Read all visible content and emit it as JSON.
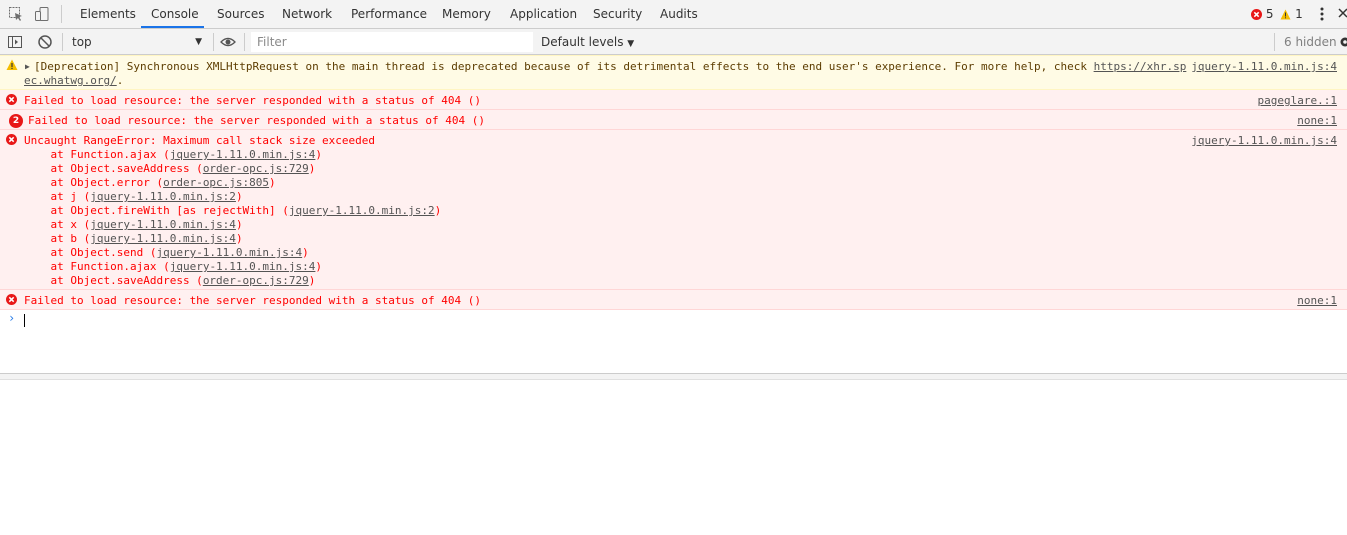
{
  "tabs": [
    {
      "label": "Elements"
    },
    {
      "label": "Console"
    },
    {
      "label": "Sources"
    },
    {
      "label": "Network"
    },
    {
      "label": "Performance"
    },
    {
      "label": "Memory"
    },
    {
      "label": "Application"
    },
    {
      "label": "Security"
    },
    {
      "label": "Audits"
    }
  ],
  "active_tab": "Console",
  "counts": {
    "errors": "5",
    "warnings": "1"
  },
  "toolbar": {
    "context": "top",
    "filter_placeholder": "Filter",
    "levels": "Default levels",
    "hidden": "6 hidden"
  },
  "messages": {
    "warning": {
      "line1": "[Deprecation] Synchronous XMLHttpRequest on the main thread is deprecated because of its detrimental effects to the end user's experience. For more help, check ",
      "link1": "https://xhr.sp",
      "link2": "ec.whatwg.org/",
      "tail": ".",
      "source": "jquery-1.11.0.min.js:4"
    },
    "error1": {
      "text": "Failed to load resource: the server responded with a status of 404 ()",
      "source": "pageglare.:1"
    },
    "error2": {
      "count": "2",
      "text": "Failed to load resource: the server responded with a status of 404 ()",
      "source": "none:1"
    },
    "error3": {
      "text": "Uncaught RangeError: Maximum call stack size exceeded",
      "source": "jquery-1.11.0.min.js:4",
      "stack": [
        {
          "prefix": "    at Function.ajax (",
          "link": "jquery-1.11.0.min.js:4",
          "suffix": ")"
        },
        {
          "prefix": "    at Object.saveAddress (",
          "link": "order-opc.js:729",
          "suffix": ")"
        },
        {
          "prefix": "    at Object.error (",
          "link": "order-opc.js:805",
          "suffix": ")"
        },
        {
          "prefix": "    at j (",
          "link": "jquery-1.11.0.min.js:2",
          "suffix": ")"
        },
        {
          "prefix": "    at Object.fireWith [as rejectWith] (",
          "link": "jquery-1.11.0.min.js:2",
          "suffix": ")"
        },
        {
          "prefix": "    at x (",
          "link": "jquery-1.11.0.min.js:4",
          "suffix": ")"
        },
        {
          "prefix": "    at b (",
          "link": "jquery-1.11.0.min.js:4",
          "suffix": ")"
        },
        {
          "prefix": "    at Object.send (",
          "link": "jquery-1.11.0.min.js:4",
          "suffix": ")"
        },
        {
          "prefix": "    at Function.ajax (",
          "link": "jquery-1.11.0.min.js:4",
          "suffix": ")"
        },
        {
          "prefix": "    at Object.saveAddress (",
          "link": "order-opc.js:729",
          "suffix": ")"
        }
      ]
    },
    "error4": {
      "text": "Failed to load resource: the server responded with a status of 404 ()",
      "source": "none:1"
    }
  },
  "colors": {
    "accent": "#1a73e8",
    "error": "#ff0000",
    "error_bg": "#fff0f0",
    "warning_bg": "#fffbe5"
  }
}
